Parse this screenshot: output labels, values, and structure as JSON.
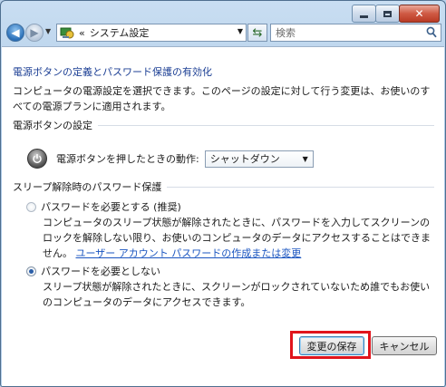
{
  "window": {
    "controls": {
      "minimize_icon": "minimize",
      "maximize_icon": "maximize",
      "close_icon": "close"
    }
  },
  "nav": {
    "back_icon": "back-arrow",
    "forward_icon": "forward-arrow",
    "breadcrumb_chevron": "«",
    "breadcrumb": "システム設定",
    "refresh_icon": "refresh",
    "search_placeholder": "検索"
  },
  "content": {
    "heading": "電源ボタンの定義とパスワード保護の有効化",
    "description": "コンピュータの電源設定を選択できます。このページの設定に対して行う変更は、お使いのすべての電源プランに適用されます。",
    "power_section": {
      "title": "電源ボタンの設定",
      "label": "電源ボタンを押したときの動作:",
      "selected": "シャットダウン"
    },
    "password_section": {
      "title": "スリープ解除時のパスワード保護",
      "option1": {
        "label": "パスワードを必要とする (推奨)",
        "desc": "コンピュータのスリープ状態が解除されたときに、パスワードを入力してスクリーンのロックを解除しない限り、お使いのコンピュータのデータにアクセスすることはできません。",
        "link": "ユーザー アカウント パスワードの作成または変更",
        "checked": false
      },
      "option2": {
        "label": "パスワードを必要としない",
        "desc": "スリープ状態が解除されたときに、スクリーンがロックされていないため誰でもお使いのコンピュータのデータにアクセスできます。",
        "checked": true
      }
    },
    "buttons": {
      "save": "変更の保存",
      "cancel": "キャンセル"
    }
  },
  "colors": {
    "heading": "#1c3f94",
    "link": "#1a55c0",
    "highlight": "#e0141c"
  }
}
